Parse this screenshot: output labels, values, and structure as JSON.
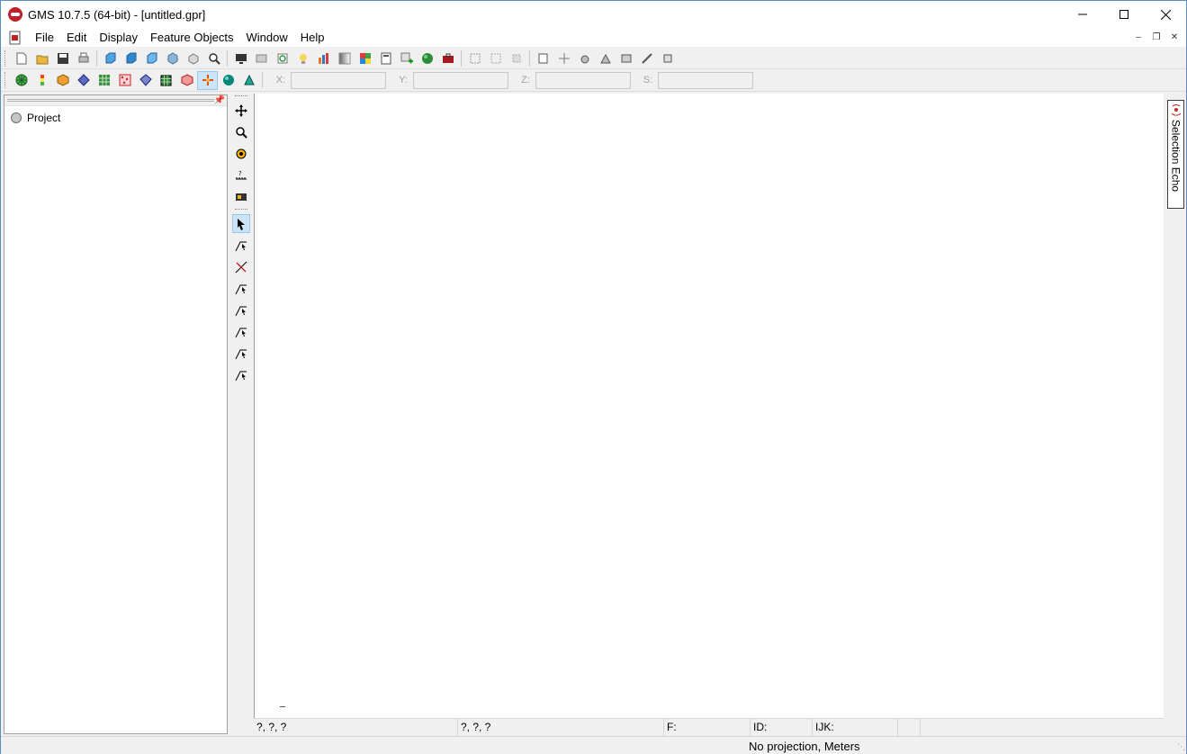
{
  "titlebar": {
    "title": "GMS 10.7.5 (64-bit) - [untitled.gpr]",
    "minimize": "minimize",
    "maximize": "maximize",
    "close": "close"
  },
  "menubar": {
    "items": [
      "File",
      "Edit",
      "Display",
      "Feature Objects",
      "Window",
      "Help"
    ]
  },
  "coords": {
    "x_label": "X:",
    "y_label": "Y:",
    "z_label": "Z:",
    "s_label": "S:",
    "x_value": "",
    "y_value": "",
    "z_value": "",
    "s_value": ""
  },
  "explorer": {
    "root_label": "Project"
  },
  "side_panel": {
    "selection_echo": "Selection Echo"
  },
  "status": {
    "cursor_xyz": "?, ?, ?",
    "cursor_xyz2": "?, ?, ?",
    "f_label": "F:",
    "id_label": "ID:",
    "ijk_label": "IJK:",
    "projection": "No projection, Meters"
  },
  "colors": {
    "window_border": "#5a8ec7",
    "chrome": "#f0f0f0",
    "canvas": "#ffffff",
    "accent_red": "#c0202a"
  }
}
